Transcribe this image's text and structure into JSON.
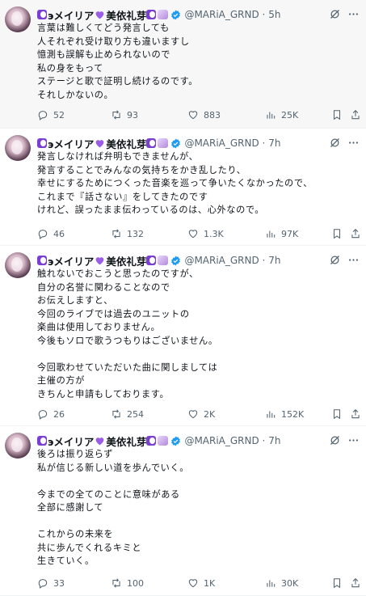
{
  "tweets": [
    {
      "author": {
        "name": "эメイリア",
        "name_suffix": "美依礼芽",
        "handle": "@MARiA_GRND"
      },
      "time": "5h",
      "text": "言葉は難しくてどう発言しても\n人それぞれ受け取り方も違いますし\n憶測も誤解も止められないので\n私の身をもって\nステージと歌で証明し続けるのです。\nそれしかないの。",
      "stats": {
        "replies": "52",
        "reposts": "93",
        "likes": "883",
        "views": "25K"
      }
    },
    {
      "author": {
        "name": "эメイリア",
        "name_suffix": "美依礼芽",
        "handle": "@MARiA_GRND"
      },
      "time": "7h",
      "text": "発言しなければ弁明もできませんが、\n発言することでみんなの気持ちをかき乱したり、\n幸せにするためにつくった音楽を巡って争いたくなかったので、\nこれまで『話さない』をしてきたのです\nけれど、誤ったまま伝わっているのは、心外なので。",
      "stats": {
        "replies": "46",
        "reposts": "132",
        "likes": "1.3K",
        "views": "97K"
      }
    },
    {
      "author": {
        "name": "эメイリア",
        "name_suffix": "美依礼芽",
        "handle": "@MARiA_GRND"
      },
      "time": "7h",
      "text": "触れないでおこうと思ったのですが、\n自分の名誉に関わることなので\nお伝えしますと、\n今回のライブでは過去のユニットの\n楽曲は使用しておりません。\n今後もソロで歌うつもりはございません。\n\n今回歌わせていただいた曲に関しましては\n主催の方が\nきちんと申請もしております。",
      "stats": {
        "replies": "26",
        "reposts": "254",
        "likes": "2K",
        "views": "152K"
      }
    },
    {
      "author": {
        "name": "эメイリア",
        "name_suffix": "美依礼芽",
        "handle": "@MARiA_GRND"
      },
      "time": "7h",
      "text": "後ろは振り返らず\n私が信じる新しい道を歩んでいく。\n\n今までの全てのことに意味がある\n全部に感謝して\n\nこれからの未来を\n共に歩んでくれるキミと\n生きていく。",
      "stats": {
        "replies": "33",
        "reposts": "100",
        "likes": "1K",
        "views": "30K"
      }
    }
  ],
  "colors": {
    "accent": "#1d9bf0",
    "muted": "#536471",
    "heart": "#9b5de5"
  },
  "icons": [
    "reply-icon",
    "repost-icon",
    "like-icon",
    "views-icon",
    "bookmark-icon",
    "share-icon",
    "grok-icon",
    "more-icon",
    "verified-icon"
  ]
}
